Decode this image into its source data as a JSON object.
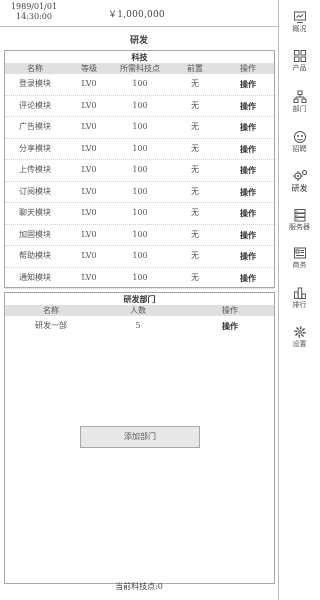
{
  "header": {
    "date": "1989/01/01",
    "time": "14:30:00",
    "money": "￥1,000,000"
  },
  "page_title": "研发",
  "tech_panel": {
    "title": "科技",
    "columns": [
      "名称",
      "等级",
      "所需科技点",
      "前置",
      "操作"
    ],
    "rows": [
      {
        "name": "登录模块",
        "level": "LV0",
        "points": "100",
        "prereq": "无",
        "action": "操作"
      },
      {
        "name": "评论模块",
        "level": "LV0",
        "points": "100",
        "prereq": "无",
        "action": "操作"
      },
      {
        "name": "广告模块",
        "level": "LV0",
        "points": "100",
        "prereq": "无",
        "action": "操作"
      },
      {
        "name": "分享模块",
        "level": "LV0",
        "points": "100",
        "prereq": "无",
        "action": "操作"
      },
      {
        "name": "上传模块",
        "level": "LV0",
        "points": "100",
        "prereq": "无",
        "action": "操作"
      },
      {
        "name": "订阅模块",
        "level": "LV0",
        "points": "100",
        "prereq": "无",
        "action": "操作"
      },
      {
        "name": "聊天模块",
        "level": "LV0",
        "points": "100",
        "prereq": "无",
        "action": "操作"
      },
      {
        "name": "加固模块",
        "level": "LV0",
        "points": "100",
        "prereq": "无",
        "action": "操作"
      },
      {
        "name": "帮助模块",
        "level": "LV0",
        "points": "100",
        "prereq": "无",
        "action": "操作"
      },
      {
        "name": "通知模块",
        "level": "LV0",
        "points": "100",
        "prereq": "无",
        "action": "操作"
      }
    ]
  },
  "dept_panel": {
    "title": "研发部门",
    "columns": [
      "名称",
      "人数",
      "操作"
    ],
    "rows": [
      {
        "name": "研发一部",
        "count": "5",
        "action": "操作"
      }
    ],
    "add_button": "添加部门"
  },
  "footer": "当前科技点:0",
  "sidebar": {
    "items": [
      {
        "label": "概况",
        "icon": "monitor-icon"
      },
      {
        "label": "产品",
        "icon": "grid-icon"
      },
      {
        "label": "部门",
        "icon": "org-chart-icon"
      },
      {
        "label": "招聘",
        "icon": "recruit-icon"
      },
      {
        "label": "研发",
        "icon": "research-icon",
        "active": true
      },
      {
        "label": "服务器",
        "icon": "server-icon"
      },
      {
        "label": "商务",
        "icon": "business-icon"
      },
      {
        "label": "排行",
        "icon": "ranking-icon"
      },
      {
        "label": "设置",
        "icon": "gear-icon"
      }
    ]
  }
}
